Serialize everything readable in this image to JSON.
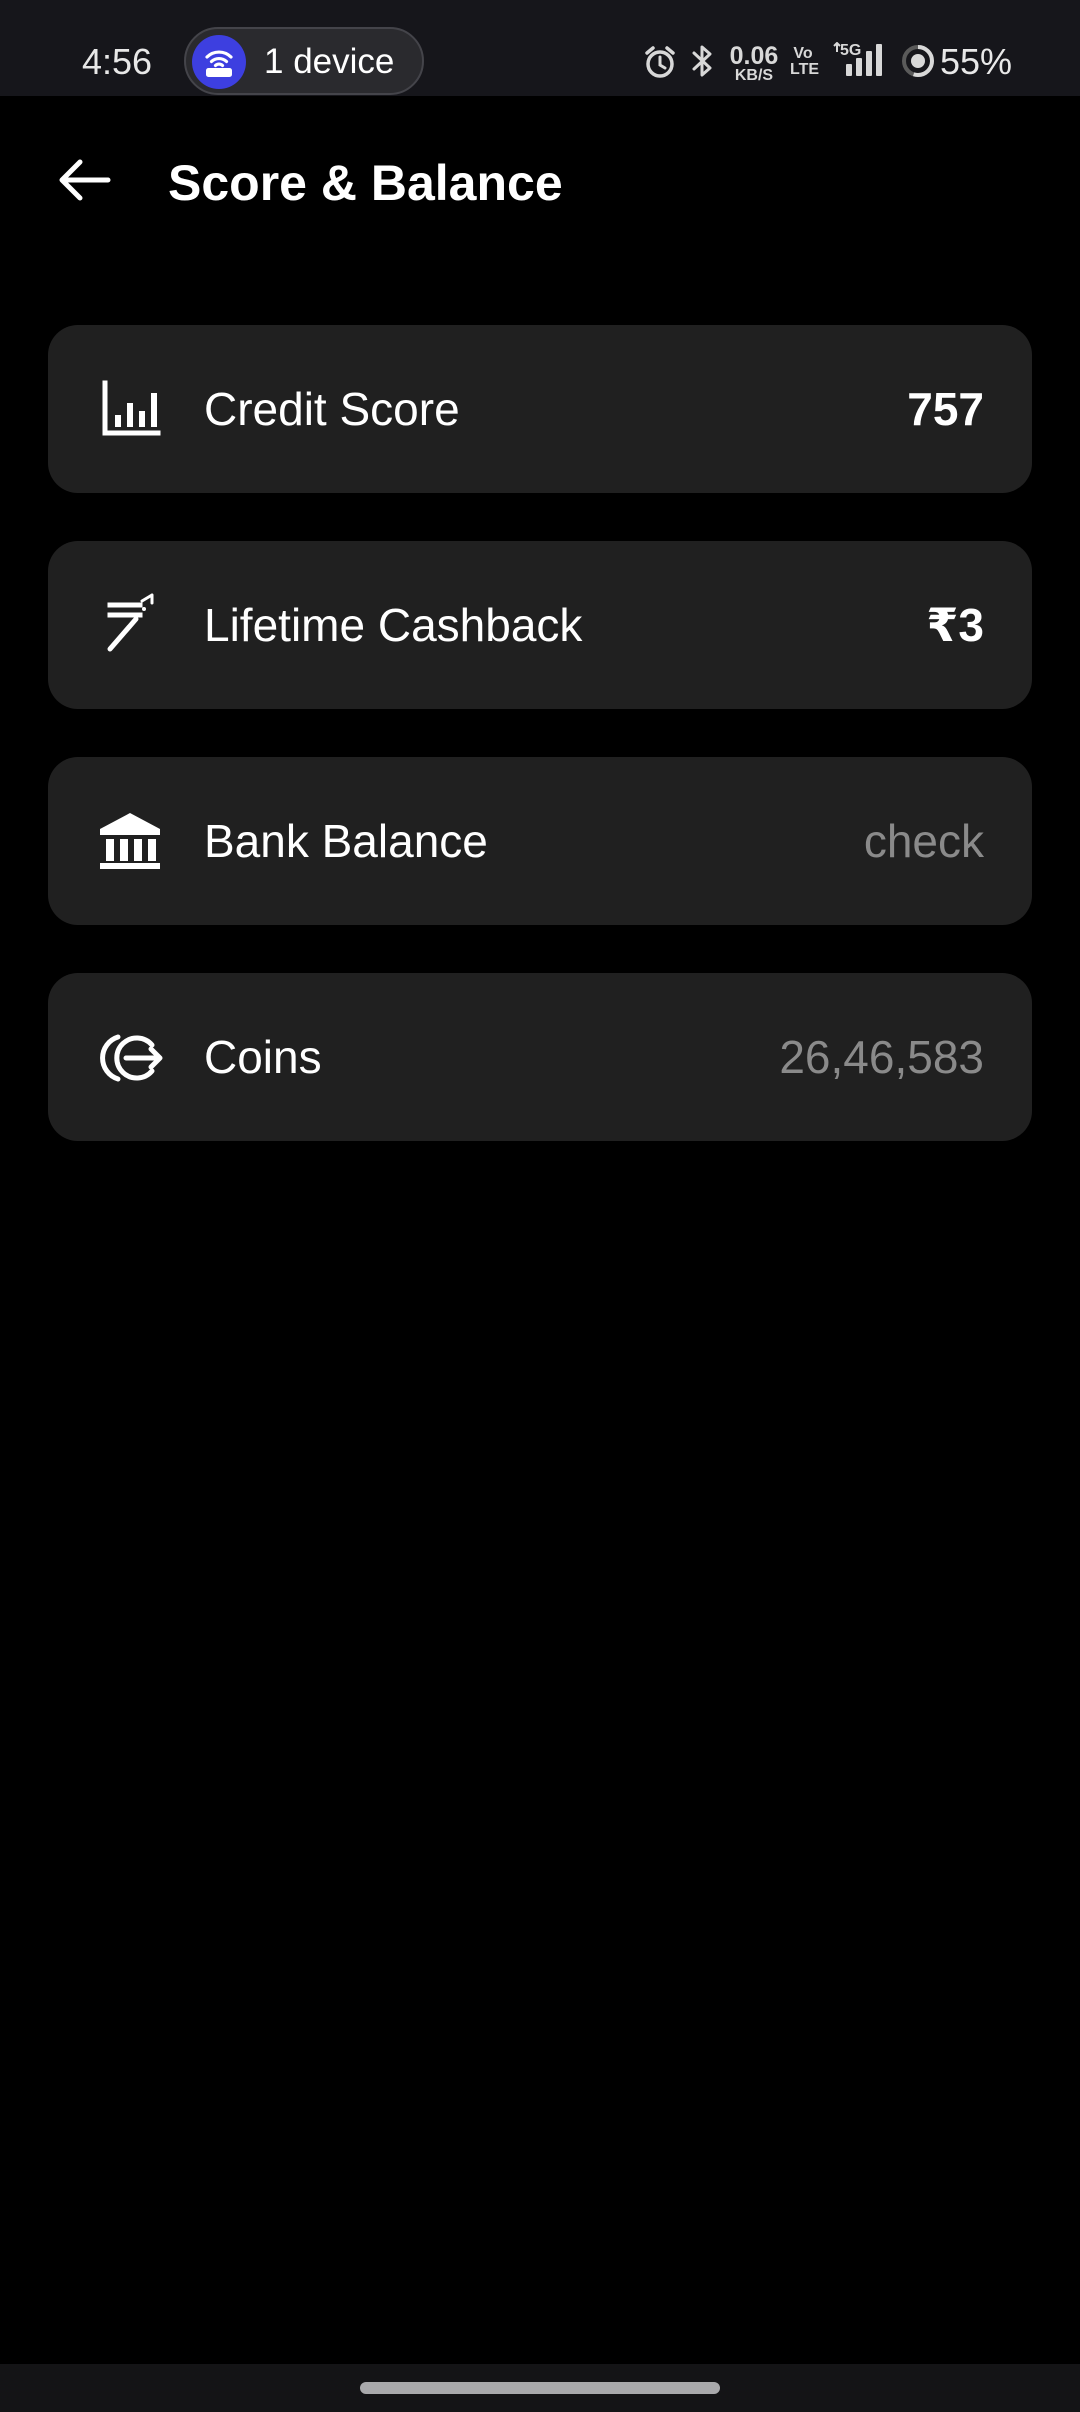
{
  "status_bar": {
    "time": "4:56",
    "hotspot_label": "1 device",
    "net_speed_value": "0.06",
    "net_speed_unit": "KB/S",
    "volte_top": "Vo",
    "volte_bottom": "LTE",
    "network_type": "5G",
    "battery_percent": "55%",
    "icons": [
      "hotspot-icon",
      "alarm-icon",
      "bluetooth-icon",
      "signal-icon",
      "battery-icon"
    ]
  },
  "header": {
    "title": "Score & Balance",
    "back_icon": "arrow-left-icon"
  },
  "cards": [
    {
      "label": "Credit Score",
      "value": "757",
      "icon": "bar-chart-icon",
      "value_style": "strong"
    },
    {
      "label": "Lifetime Cashback",
      "value": "₹3",
      "icon": "rupee-cashback-icon",
      "value_style": "strong"
    },
    {
      "label": "Bank Balance",
      "value": "check",
      "icon": "bank-icon",
      "value_style": "muted"
    },
    {
      "label": "Coins",
      "value": "26,46,583",
      "icon": "coins-icon",
      "value_style": "muted"
    }
  ],
  "colors": {
    "background": "#000000",
    "card": "#202020",
    "status_bar": "#16161b",
    "hotspot_accent": "#3d3fe0",
    "muted_text": "#8a8a8a"
  }
}
